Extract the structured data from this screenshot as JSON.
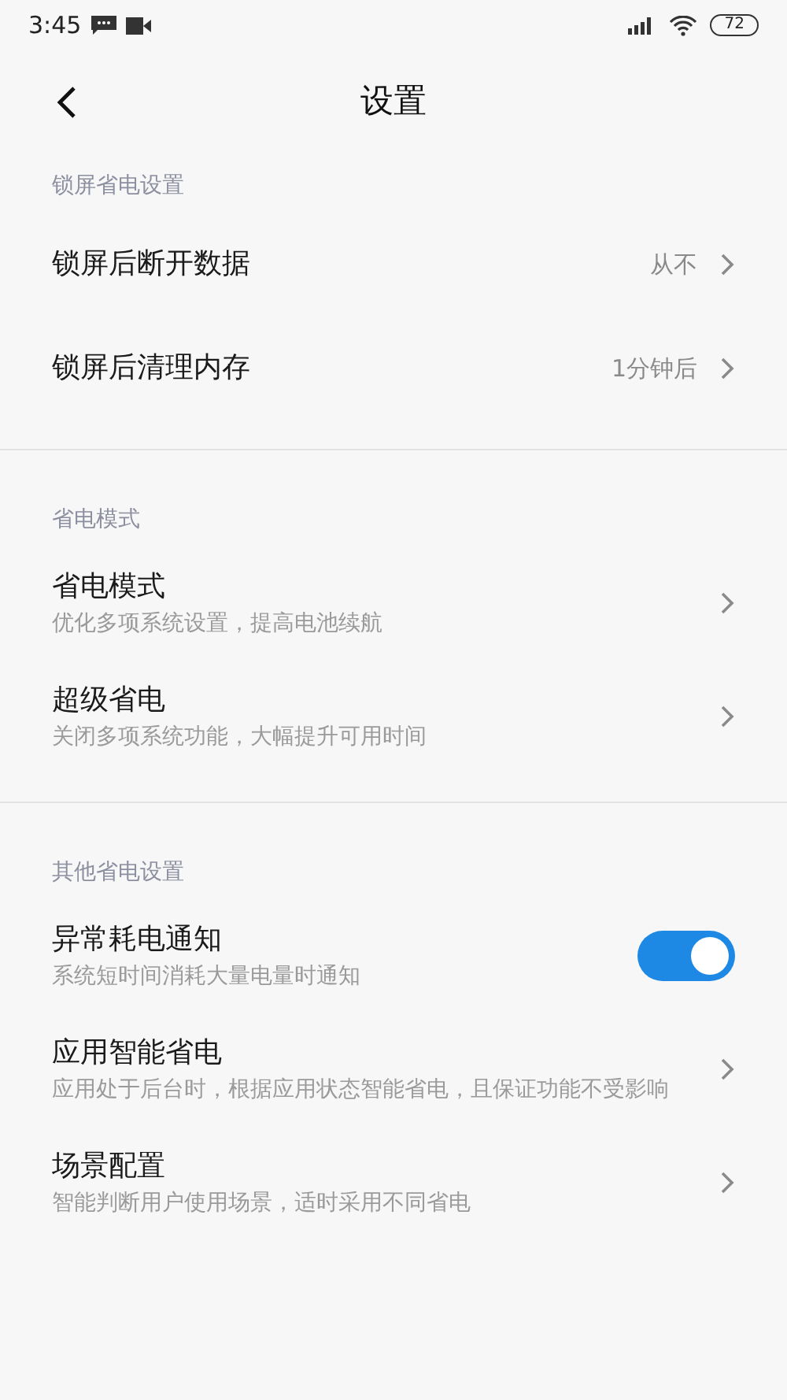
{
  "status_bar": {
    "time": "3:45",
    "battery": "72"
  },
  "header": {
    "title": "设置"
  },
  "sections": [
    {
      "title": "锁屏省电设置",
      "items": [
        {
          "kind": "link",
          "title": "锁屏后断开数据",
          "value": "从不"
        },
        {
          "kind": "link",
          "title": "锁屏后清理内存",
          "value": "1分钟后"
        }
      ]
    },
    {
      "title": "省电模式",
      "items": [
        {
          "kind": "link",
          "title": "省电模式",
          "subtitle": "优化多项系统设置，提高电池续航"
        },
        {
          "kind": "link",
          "title": "超级省电",
          "subtitle": "关闭多项系统功能，大幅提升可用时间"
        }
      ]
    },
    {
      "title": "其他省电设置",
      "items": [
        {
          "kind": "toggle",
          "title": "异常耗电通知",
          "subtitle": "系统短时间消耗大量电量时通知",
          "on": true
        },
        {
          "kind": "link",
          "title": "应用智能省电",
          "subtitle": "应用处于后台时，根据应用状态智能省电，且保证功能不受影响"
        },
        {
          "kind": "link",
          "title": "场景配置",
          "subtitle": "智能判断用户使用场景，适时采用不同省电"
        }
      ]
    }
  ]
}
